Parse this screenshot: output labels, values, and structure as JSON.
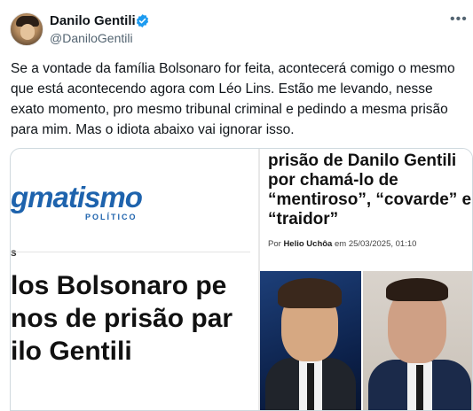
{
  "author": {
    "display_name": "Danilo Gentili",
    "handle": "@DaniloGentili",
    "verified": true,
    "avatar_icon": "avatar-photo"
  },
  "tweet": {
    "text": "Se a vontade da família Bolsonaro for feita, acontecerá comigo o mesmo que está acontecendo agora com Léo Lins. Estão me levando, nesse exato momento, pro mesmo tribunal criminal e pedindo a mesma prisão para mim. Mas o idiota abaixo vai ignorar isso.",
    "more_icon": "more-options-icon"
  },
  "media": {
    "left": {
      "logo_main": "gmatismo",
      "logo_sub": "POLÍTICO",
      "snippet_s": "s",
      "headline": "los Bolsonaro pe\nnos de prisão par\nilo Gentili"
    },
    "right": {
      "headline": "prisão de Danilo Gentili por chamá-lo de “mentiroso”, “covarde” e “traidor”",
      "byline_prefix": "Por",
      "byline_author": "Helio Uchôa",
      "byline_suffix": "em 25/03/2025, 01:10"
    }
  },
  "colors": {
    "verified": "#1d9bf0",
    "handle": "#536471",
    "logo": "#1e63ad"
  }
}
